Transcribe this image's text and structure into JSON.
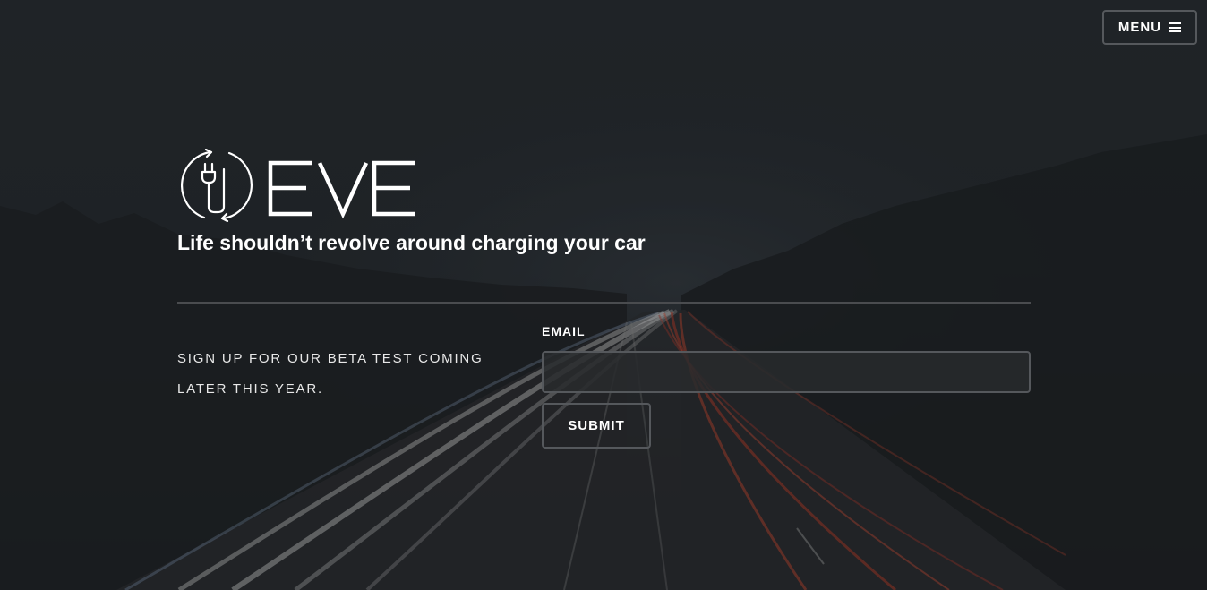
{
  "header": {
    "menu_label": "MENU",
    "menu_icon": "hamburger-icon"
  },
  "brand": {
    "name": "EVE",
    "logo_icon": "charging-plug-cycle-icon",
    "tagline": "Life shouldn’t revolve around charging your car"
  },
  "signup": {
    "description": "SIGN UP FOR OUR BETA TEST COMING LATER THIS YEAR.",
    "email_label": "EMAIL",
    "email_value": "",
    "submit_label": "SUBMIT"
  },
  "colors": {
    "background": "#1d1f22",
    "text": "#ffffff",
    "border": "#55585c",
    "divider": "#4a4c4f",
    "light_trail_red": "#c0442e",
    "light_trail_white": "#d9d9d9"
  }
}
